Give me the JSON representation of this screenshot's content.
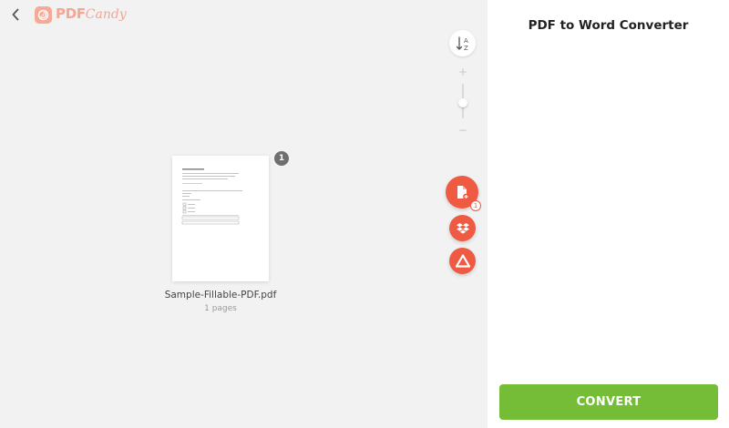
{
  "header": {
    "back_icon": "chevron-left-icon",
    "logo_strong": "PDF",
    "logo_light": "Candy"
  },
  "toolbar": {
    "sort_icon": "sort-az-icon",
    "sort_label_a": "A",
    "sort_label_z": "Z",
    "zoom_plus": "+",
    "zoom_minus": "−"
  },
  "file": {
    "name": "Sample-Fillable-PDF.pdf",
    "pages": "1 pages",
    "badge": "1"
  },
  "actions": {
    "add_file_icon": "file-plus-icon",
    "add_count": "1",
    "dropbox_icon": "dropbox-icon",
    "drive_icon": "google-drive-icon"
  },
  "sidebar": {
    "title": "PDF to Word Converter",
    "convert_label": "CONVERT"
  },
  "colors": {
    "accent": "#ef5a43",
    "convert": "#76bd37",
    "logo": "#f4a593"
  }
}
